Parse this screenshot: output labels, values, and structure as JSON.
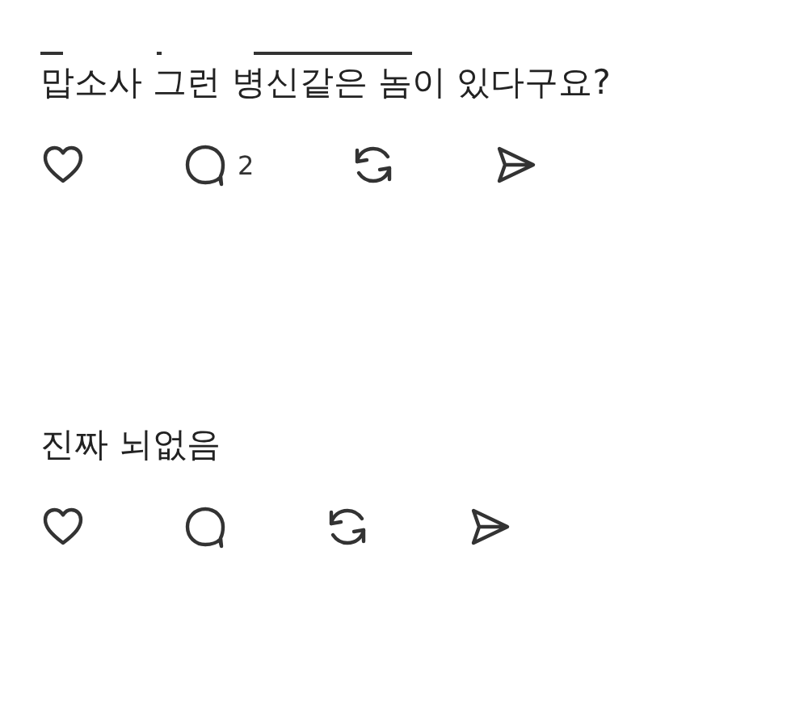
{
  "posts": [
    {
      "text": "맙소사 그런 병신같은 놈이 있다구요?",
      "actions": [
        {
          "kind": "like"
        },
        {
          "kind": "comment",
          "count": "2"
        },
        {
          "kind": "repost"
        },
        {
          "kind": "share"
        }
      ]
    },
    {
      "text": "진짜 뇌없음",
      "actions": [
        {
          "kind": "like"
        },
        {
          "kind": "comment"
        },
        {
          "kind": "repost"
        },
        {
          "kind": "share"
        }
      ]
    }
  ]
}
